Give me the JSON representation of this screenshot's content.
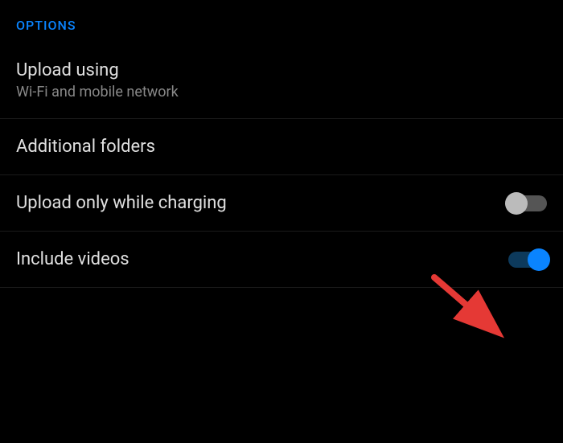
{
  "section": {
    "header": "OPTIONS"
  },
  "rows": {
    "upload_using": {
      "title": "Upload using",
      "subtitle": "Wi-Fi and mobile network"
    },
    "additional_folders": {
      "title": "Additional folders"
    },
    "upload_only_while_charging": {
      "title": "Upload only while charging",
      "toggle_state": "off"
    },
    "include_videos": {
      "title": "Include videos",
      "toggle_state": "on"
    }
  },
  "accent_color": "#0a84ff"
}
